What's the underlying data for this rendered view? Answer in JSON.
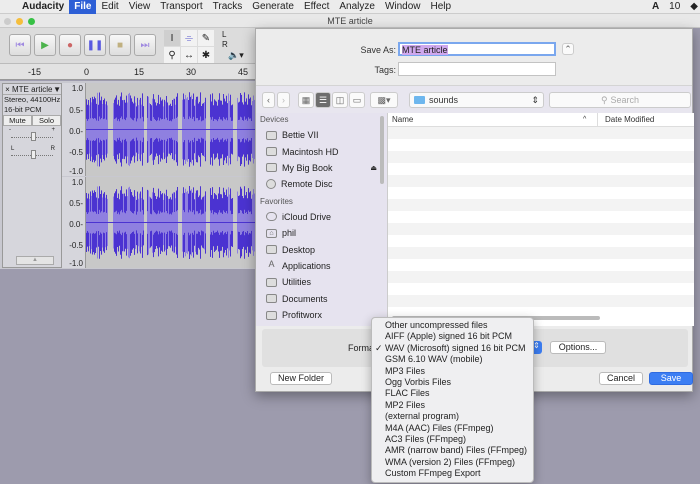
{
  "menubar": {
    "app": "Audacity",
    "items": [
      "File",
      "Edit",
      "View",
      "Transport",
      "Tracks",
      "Generate",
      "Effect",
      "Analyze",
      "Window",
      "Help"
    ],
    "selected": "File",
    "status": "10"
  },
  "window": {
    "title": "MTE article"
  },
  "ruler": {
    "ticks": [
      "-15",
      "0",
      "15",
      "30",
      "45"
    ]
  },
  "track": {
    "name": "MTE article",
    "format": "Stereo, 44100Hz",
    "bitdepth": "16-bit PCM",
    "mute": "Mute",
    "solo": "Solo",
    "gain_minus": "-",
    "gain_plus": "+",
    "pan_l": "L",
    "pan_r": "R",
    "scale": [
      "1.0",
      "0.5-",
      "0.0-",
      "-0.5",
      "-1.0"
    ]
  },
  "meter": {
    "l": "L",
    "r": "R"
  },
  "dialog": {
    "save_as_label": "Save As:",
    "save_as_value": "MTE article",
    "tags_label": "Tags:",
    "tags_value": "",
    "location": "sounds",
    "search_placeholder": "Search",
    "sidebar": {
      "devices_header": "Devices",
      "devices": [
        "Bettie VII",
        "Macintosh HD",
        "My Big Book",
        "Remote Disc"
      ],
      "favorites_header": "Favorites",
      "favorites": [
        "iCloud Drive",
        "phil",
        "Desktop",
        "Applications",
        "Utilities",
        "Documents",
        "Profitworx"
      ]
    },
    "columns": {
      "name": "Name",
      "date": "Date Modified"
    },
    "format_label": "Format:",
    "options": "Options...",
    "new_folder": "New Folder",
    "cancel": "Cancel",
    "save": "Save"
  },
  "format_menu": {
    "items": [
      "Other uncompressed files",
      "AIFF (Apple) signed 16 bit PCM",
      "WAV (Microsoft) signed 16 bit PCM",
      "GSM 6.10 WAV (mobile)",
      "MP3 Files",
      "Ogg Vorbis Files",
      "FLAC Files",
      "MP2 Files",
      "(external program)",
      "M4A (AAC) Files (FFmpeg)",
      "AC3 Files (FFmpeg)",
      "AMR (narrow band) Files (FFmpeg)",
      "WMA (version 2) Files (FFmpeg)",
      "Custom FFmpeg Export"
    ],
    "selected_index": 2,
    "check": "✓"
  },
  "colors": {
    "accent": "#2d5fd6",
    "wave_dark": "#4b33d1",
    "wave_light": "#8f80e0",
    "selection": "#cfa8ee",
    "save_button": "#3c7ef3"
  }
}
